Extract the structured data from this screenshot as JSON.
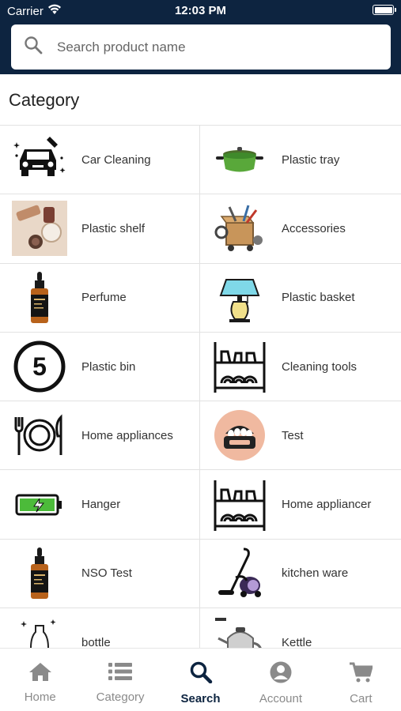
{
  "status_bar": {
    "carrier": "Carrier",
    "time": "12:03 PM"
  },
  "search": {
    "placeholder": "Search product name"
  },
  "section_title": "Category",
  "categories": [
    {
      "label": "Car Cleaning",
      "icon": "car-icon"
    },
    {
      "label": "Plastic tray",
      "icon": "pot-icon"
    },
    {
      "label": "Plastic shelf",
      "icon": "cosmetics-photo"
    },
    {
      "label": "Accessories",
      "icon": "tools-box-icon"
    },
    {
      "label": "Perfume",
      "icon": "dropper-bottle-icon"
    },
    {
      "label": "Plastic basket",
      "icon": "lamp-icon"
    },
    {
      "label": "Plastic bin",
      "icon": "number-five-icon"
    },
    {
      "label": "Cleaning tools",
      "icon": "dish-rack-icon"
    },
    {
      "label": "Home appliances",
      "icon": "plate-cutlery-icon"
    },
    {
      "label": "Test",
      "icon": "egg-boiler-icon"
    },
    {
      "label": "Hanger",
      "icon": "battery-charging-icon"
    },
    {
      "label": "Home appliancer",
      "icon": "dish-rack-icon"
    },
    {
      "label": "NSO Test",
      "icon": "dropper-bottle-icon"
    },
    {
      "label": "kitchen ware",
      "icon": "vacuum-cleaner-icon"
    },
    {
      "label": "bottle",
      "icon": "bottle-sparkle-icon"
    },
    {
      "label": "Kettle",
      "icon": "kettle-icon"
    }
  ],
  "tabs": [
    {
      "label": "Home",
      "icon": "home-icon",
      "active": false
    },
    {
      "label": "Category",
      "icon": "list-icon",
      "active": false
    },
    {
      "label": "Search",
      "icon": "search-icon",
      "active": true
    },
    {
      "label": "Account",
      "icon": "account-icon",
      "active": false
    },
    {
      "label": "Cart",
      "icon": "cart-icon",
      "active": false
    }
  ],
  "colors": {
    "header": "#0d2440",
    "active_tab": "#0d2440",
    "inactive_tab": "#8a8a8a"
  }
}
